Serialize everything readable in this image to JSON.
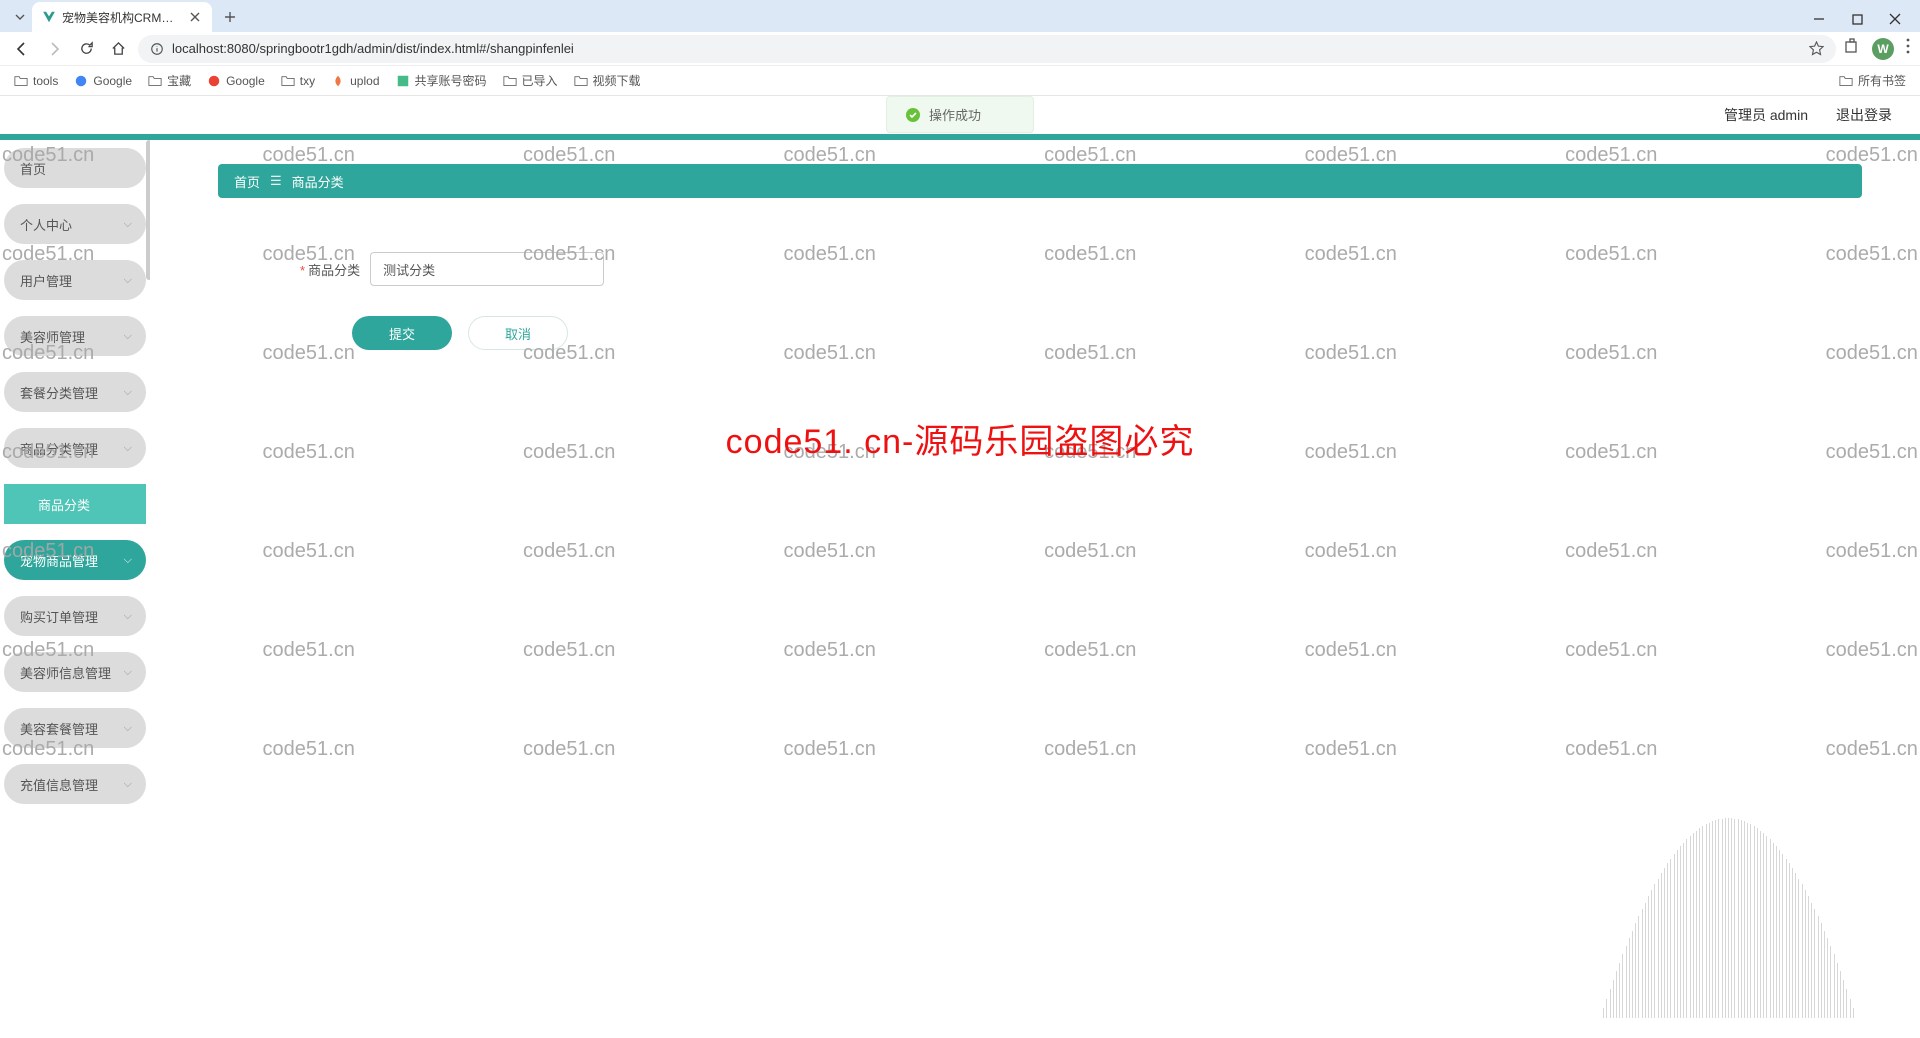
{
  "browser": {
    "tab_title": "宠物美容机构CRM系统设计与",
    "url": "localhost:8080/springbootr1gdh/admin/dist/index.html#/shangpinfenlei",
    "avatar_letter": "W",
    "bookmarks": [
      "tools",
      "Google",
      "宝藏",
      "Google",
      "txy",
      "uplod",
      "共享账号密码",
      "已导入",
      "视频下载"
    ],
    "all_bookmarks": "所有书签"
  },
  "header": {
    "user_label": "管理员 admin",
    "logout": "退出登录"
  },
  "toast": {
    "text": "操作成功"
  },
  "sidebar": {
    "items": [
      {
        "label": "首页",
        "expandable": false
      },
      {
        "label": "个人中心",
        "expandable": true
      },
      {
        "label": "用户管理",
        "expandable": true
      },
      {
        "label": "美容师管理",
        "expandable": true
      },
      {
        "label": "套餐分类管理",
        "expandable": true
      },
      {
        "label": "商品分类管理",
        "expandable": true
      },
      {
        "label": "商品分类",
        "expandable": false,
        "sub": true
      },
      {
        "label": "宠物商品管理",
        "expandable": true,
        "active": true
      },
      {
        "label": "购买订单管理",
        "expandable": true
      },
      {
        "label": "美容师信息管理",
        "expandable": true
      },
      {
        "label": "美容套餐管理",
        "expandable": true
      },
      {
        "label": "充值信息管理",
        "expandable": true
      }
    ]
  },
  "breadcrumb": {
    "home": "首页",
    "current": "商品分类"
  },
  "form": {
    "label": "商品分类",
    "value": "测试分类",
    "submit": "提交",
    "cancel": "取消"
  },
  "watermark": {
    "repeat": "code51.cn",
    "big": "code51. cn-源码乐园盗图必究"
  }
}
